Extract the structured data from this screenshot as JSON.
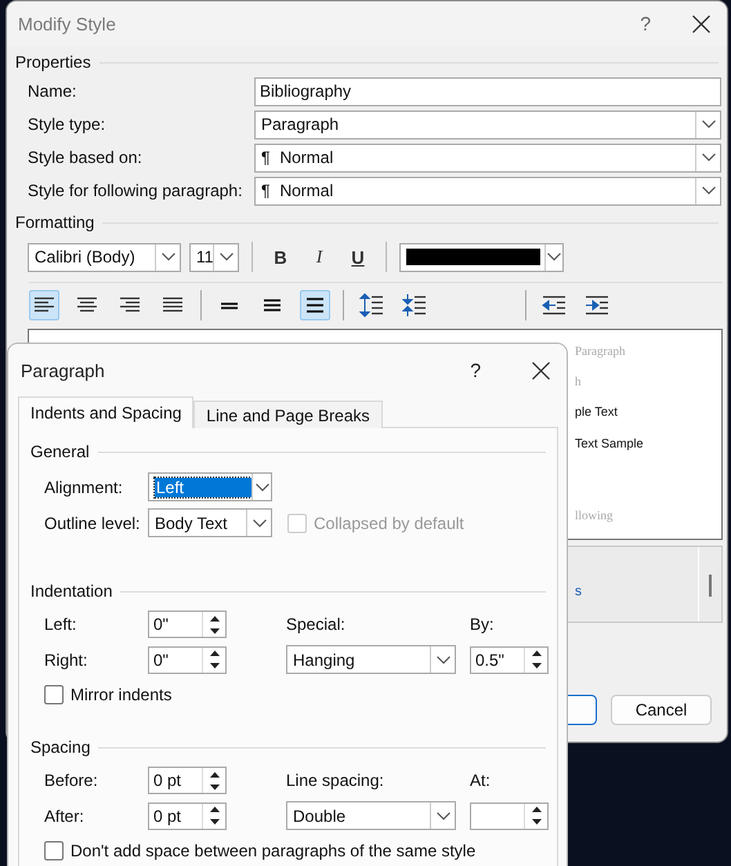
{
  "modify_style": {
    "title": "Modify Style",
    "help": "?",
    "properties": {
      "legend": "Properties",
      "rows": [
        {
          "label": "Name:",
          "kind": "text",
          "value": "Bibliography"
        },
        {
          "label": "Style type:",
          "kind": "dropdown",
          "value": "Paragraph"
        },
        {
          "label": "Style based on:",
          "kind": "dropdown",
          "prefix": "¶",
          "value": "Normal"
        },
        {
          "label": "Style for following paragraph:",
          "kind": "dropdown",
          "prefix": "¶",
          "value": "Normal"
        }
      ]
    },
    "formatting": {
      "legend": "Formatting",
      "font": "Calibri (Body)",
      "size": "11",
      "styles": [
        {
          "kind": "bold",
          "label": "B"
        },
        {
          "kind": "italic",
          "label": "I"
        },
        {
          "kind": "underline",
          "label": "U"
        }
      ],
      "color": "#000000",
      "tools": [
        {
          "kind": "align-left",
          "selected": true
        },
        {
          "kind": "align-center",
          "selected": false
        },
        {
          "kind": "align-right",
          "selected": false
        },
        {
          "kind": "justify",
          "selected": false
        },
        {
          "kind": "sep"
        },
        {
          "kind": "single",
          "selected": false
        },
        {
          "kind": "one-half",
          "selected": false
        },
        {
          "kind": "double",
          "selected": true
        },
        {
          "kind": "sep"
        },
        {
          "kind": "space-more",
          "selected": false
        },
        {
          "kind": "space-less",
          "selected": false
        },
        {
          "kind": "sep-wide"
        },
        {
          "kind": "outdent",
          "selected": false
        },
        {
          "kind": "indent",
          "selected": false
        }
      ]
    },
    "preview": [
      {
        "kind": "previous",
        "text": "Paragraph"
      },
      {
        "kind": "previous",
        "text": "h"
      },
      {
        "kind": "sample",
        "text": "ple Text"
      },
      {
        "kind": "sample",
        "text": "Text Sample"
      },
      {
        "kind": "following",
        "text": "llowing"
      }
    ],
    "description": {
      "fragment": "s"
    },
    "cancel": "Cancel"
  },
  "paragraph": {
    "title": "Paragraph",
    "help": "?",
    "tabs": [
      {
        "label": "Indents and Spacing",
        "selected": true
      },
      {
        "label": "Line and Page Breaks",
        "selected": false
      }
    ],
    "general": {
      "legend": "General",
      "alignment": {
        "label": "Alignment:",
        "value": "Left",
        "highlighted": true
      },
      "outline": {
        "label": "Outline level:",
        "value": "Body Text"
      },
      "collapsed": {
        "label": "Collapsed by default",
        "checked": false,
        "disabled": true
      }
    },
    "indentation": {
      "legend": "Indentation",
      "left": {
        "label": "Left:",
        "value": "0\""
      },
      "right": {
        "label": "Right:",
        "value": "0\""
      },
      "special": {
        "label": "Special:",
        "value": "Hanging"
      },
      "by": {
        "label": "By:",
        "value": "0.5\""
      },
      "mirror": {
        "label": "Mirror indents",
        "checked": false
      }
    },
    "spacing": {
      "legend": "Spacing",
      "before": {
        "label": "Before:",
        "value": "0 pt"
      },
      "after": {
        "label": "After:",
        "value": "0 pt"
      },
      "line_spacing": {
        "label": "Line spacing:",
        "value": "Double"
      },
      "at": {
        "label": "At:"
      },
      "dont_add": {
        "label": "Don't add space between paragraphs of the same style",
        "checked": false
      }
    }
  }
}
